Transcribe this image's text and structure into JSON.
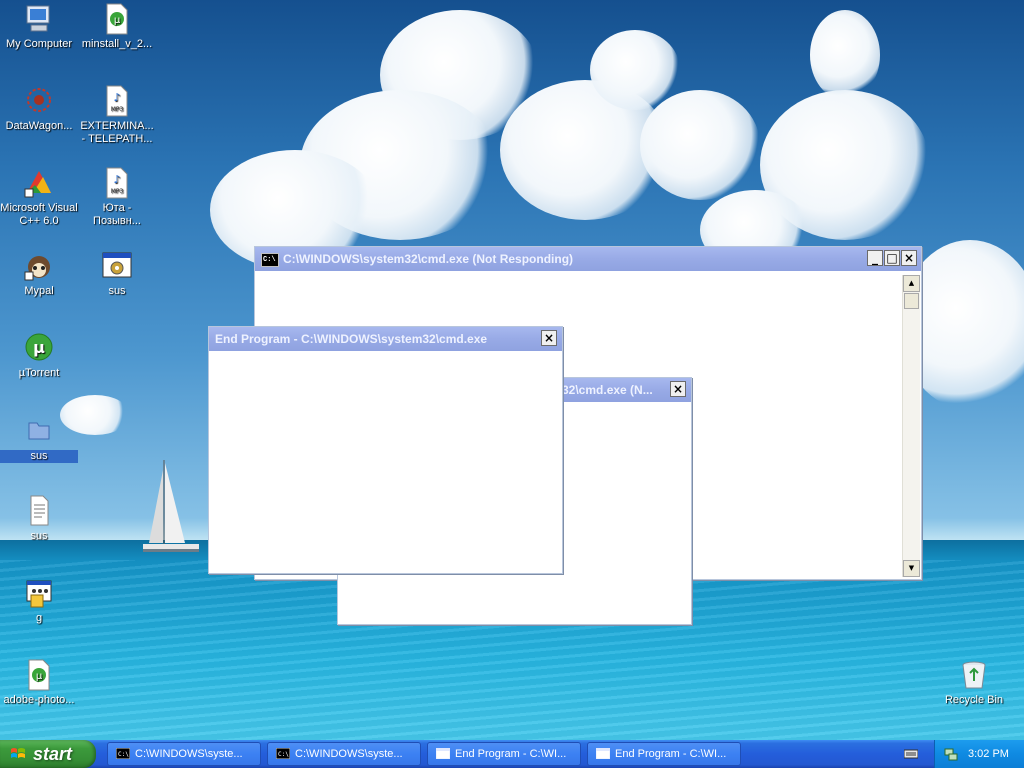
{
  "desktop": {
    "icons": [
      {
        "label": "My Computer",
        "icon": "my-computer-icon"
      },
      {
        "label": "minstall_v_2...",
        "icon": "utorrent-file-icon"
      },
      {
        "label": "DataWagon...",
        "icon": "datawagon-icon"
      },
      {
        "label": "EXTERMINA... - TELEPATH...",
        "icon": "mp3-file-icon"
      },
      {
        "label": "Microsoft Visual C++ 6.0",
        "icon": "visual-cpp-icon"
      },
      {
        "label": "Юта - Позывн...",
        "icon": "mp3-file-icon"
      },
      {
        "label": "Mypal",
        "icon": "mypal-browser-icon"
      },
      {
        "label": "sus",
        "icon": "application-icon"
      },
      {
        "label": "µTorrent",
        "icon": "utorrent-icon"
      },
      {
        "label": "sus",
        "icon": "folder-icon"
      },
      {
        "label": "sus",
        "icon": "text-file-icon"
      },
      {
        "label": "g",
        "icon": "batch-file-icon"
      },
      {
        "label": "adobe-photo...",
        "icon": "utorrent-file-icon"
      },
      {
        "label": "Recycle Bin",
        "icon": "recycle-bin-icon"
      }
    ]
  },
  "windows": {
    "cmd_main": {
      "title": "C:\\WINDOWS\\system32\\cmd.exe (Not Responding)"
    },
    "end_program_back": {
      "title": "32\\cmd.exe (N..."
    },
    "end_program_front": {
      "title": "End Program - C:\\WINDOWS\\system32\\cmd.exe"
    },
    "buttons": {
      "minimize": "_",
      "maximize": "□",
      "close": "×"
    },
    "scroll": {
      "up": "▲",
      "down": "▼"
    }
  },
  "taskbar": {
    "start_label": "start",
    "items": [
      {
        "label": "C:\\WINDOWS\\syste...",
        "icon": "cmd-icon"
      },
      {
        "label": "C:\\WINDOWS\\syste...",
        "icon": "cmd-icon"
      },
      {
        "label": "End Program - C:\\WI...",
        "icon": "window-icon"
      },
      {
        "label": "End Program - C:\\WI...",
        "icon": "window-icon"
      }
    ],
    "clock": "3:02 PM"
  },
  "colors": {
    "title_inactive": "#98aae6",
    "taskbar": "#245edb",
    "start_green": "#3c9a3c",
    "tray": "#0f8ae2"
  }
}
